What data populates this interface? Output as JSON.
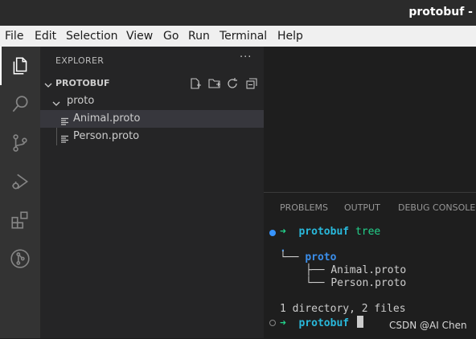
{
  "window": {
    "title": "protobuf -"
  },
  "menu": [
    "File",
    "Edit",
    "Selection",
    "View",
    "Go",
    "Run",
    "Terminal",
    "Help"
  ],
  "sidebar": {
    "title": "EXPLORER",
    "more": "···",
    "section": "PROTOBUF",
    "tree": [
      {
        "label": "proto",
        "kind": "folder",
        "expanded": true
      },
      {
        "label": "Animal.proto",
        "kind": "file",
        "selected": true
      },
      {
        "label": "Person.proto",
        "kind": "file",
        "selected": false
      }
    ]
  },
  "panel": {
    "tabs": [
      "PROBLEMS",
      "OUTPUT",
      "DEBUG CONSOLE"
    ]
  },
  "terminal": {
    "arrow": "➜",
    "cwd": "protobuf",
    "command": "tree",
    "tree_root": ".",
    "tree_branch": "└──",
    "tree_dir": "proto",
    "tree_file_1_prefix": "├──",
    "tree_file_1": "Animal.proto",
    "tree_file_2_prefix": "└──",
    "tree_file_2": "Person.proto",
    "summary": "1 directory, 2 files"
  },
  "watermark": "CSDN @AI Chen",
  "colors": {
    "accent_green": "#23d18b",
    "cwd_cyan": "#29b8db",
    "dir_blue": "#3b8eea",
    "status_dot_blue": "#3794ff"
  }
}
